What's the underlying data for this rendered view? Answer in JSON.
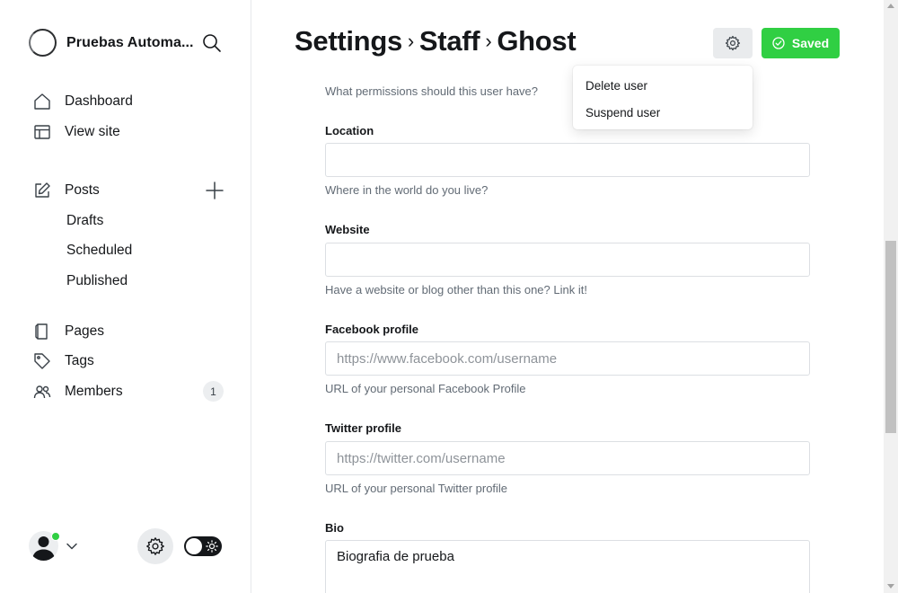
{
  "sidebar": {
    "site_name": "Pruebas Automa...",
    "nav": {
      "dashboard": "Dashboard",
      "view_site": "View site",
      "posts": "Posts",
      "drafts": "Drafts",
      "scheduled": "Scheduled",
      "published": "Published",
      "pages": "Pages",
      "tags": "Tags",
      "members": "Members",
      "members_count": "1"
    }
  },
  "header": {
    "crumb_settings": "Settings",
    "crumb_staff": "Staff",
    "crumb_user": "Ghost",
    "saved_label": "Saved"
  },
  "dropdown": {
    "items": [
      "Delete user",
      "Suspend user"
    ]
  },
  "form": {
    "role_hint": "What permissions should this user have?",
    "location": {
      "label": "Location",
      "value": "",
      "hint": "Where in the world do you live?"
    },
    "website": {
      "label": "Website",
      "value": "",
      "hint": "Have a website or blog other than this one? Link it!"
    },
    "facebook": {
      "label": "Facebook profile",
      "placeholder": "https://www.facebook.com/username",
      "hint": "URL of your personal Facebook Profile"
    },
    "twitter": {
      "label": "Twitter profile",
      "placeholder": "https://twitter.com/username",
      "hint": "URL of your personal Twitter profile"
    },
    "bio": {
      "label": "Bio",
      "value": "Biografia de prueba"
    }
  },
  "colors": {
    "accent_green": "#30cf43",
    "text": "#15171a",
    "muted": "#626b75"
  }
}
